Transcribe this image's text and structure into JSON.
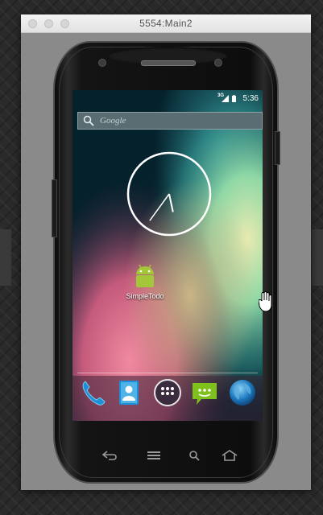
{
  "window": {
    "title": "5554:Main2"
  },
  "status_bar": {
    "network": "3G",
    "time": "5:36"
  },
  "search": {
    "placeholder": "Google",
    "icon": "search-icon"
  },
  "home_screen": {
    "widget": "analog-clock",
    "clock": {
      "hour": 5,
      "minute": 36
    },
    "app_shortcut": {
      "label": "SimpleTodo",
      "icon": "android-app-icon"
    }
  },
  "dock": [
    {
      "name": "phone",
      "icon": "phone-icon"
    },
    {
      "name": "contacts",
      "icon": "contacts-icon"
    },
    {
      "name": "all-apps",
      "icon": "app-drawer-icon"
    },
    {
      "name": "messaging",
      "icon": "messaging-icon"
    },
    {
      "name": "browser",
      "icon": "globe-icon"
    }
  ],
  "hardware_buttons": [
    "back",
    "menu",
    "search",
    "home"
  ],
  "colors": {
    "android_green": "#a4c639",
    "wallpaper_dark": "#05212b",
    "dock_blue": "#1e8fd6",
    "message_green": "#7fc11c"
  }
}
